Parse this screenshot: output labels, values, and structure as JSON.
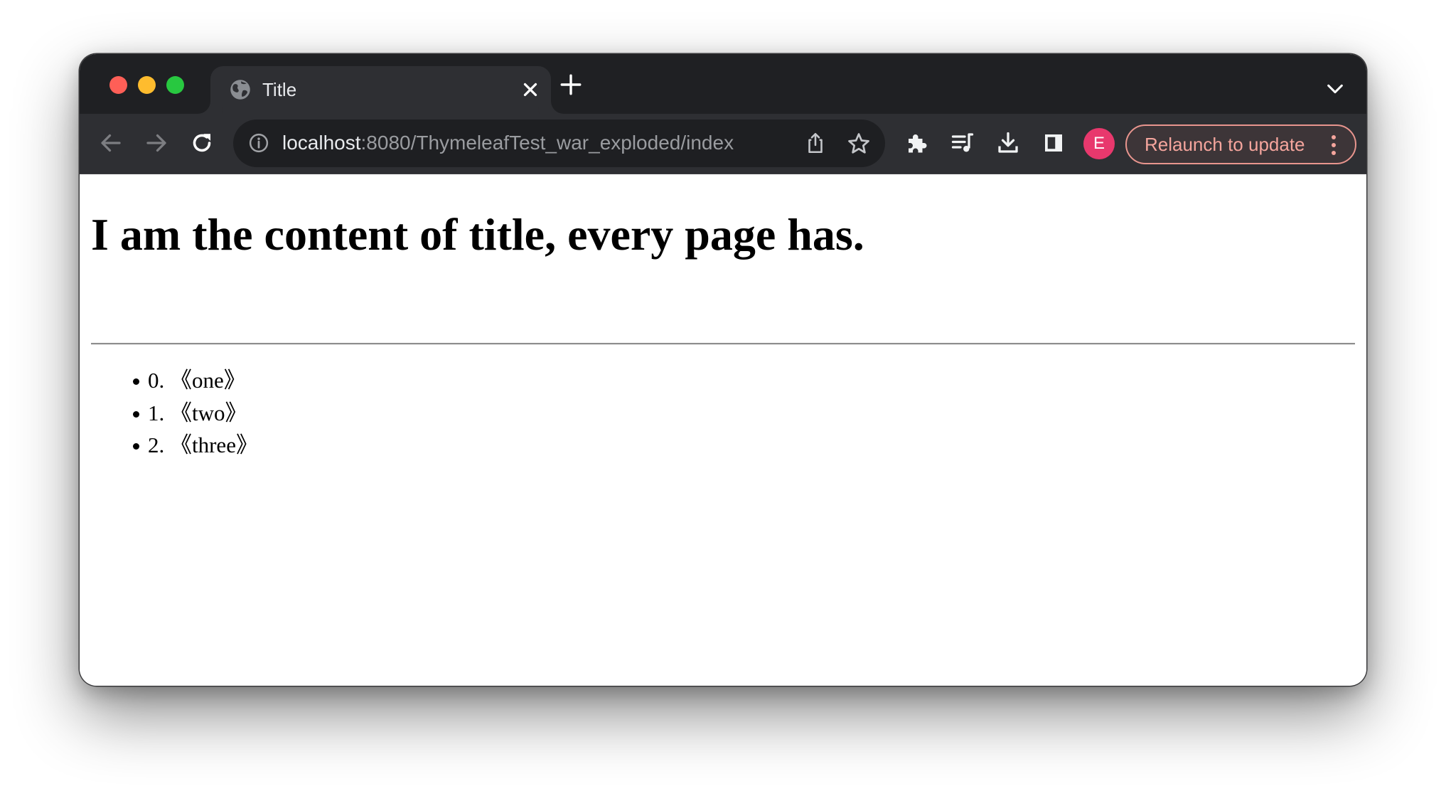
{
  "browser": {
    "tab": {
      "title": "Title",
      "favicon": "globe-icon"
    },
    "tab_strip": {
      "new_tab_icon": "plus-icon",
      "tab_search_icon": "chevron-down-icon"
    },
    "toolbar": {
      "back_icon": "arrow-left-icon",
      "forward_icon": "arrow-right-icon",
      "reload_icon": "reload-icon",
      "url_host": "localhost",
      "url_rest": ":8080/ThymeleafTest_war_exploded/index",
      "site_info_icon": "info-icon",
      "share_icon": "share-icon",
      "bookmark_icon": "star-icon",
      "extensions_icon": "puzzle-icon",
      "media_icon": "media-queue-icon",
      "downloads_icon": "download-icon",
      "side_panel_icon": "side-panel-icon",
      "profile_initial": "E",
      "relaunch_label": "Relaunch to update",
      "menu_icon": "more-vertical-icon"
    },
    "colors": {
      "frame": "#1f2023",
      "toolbar": "#2e2f33",
      "omnibox": "#1e1f22",
      "avatar": "#e8386d",
      "relaunch_accent": "#f5a59d"
    }
  },
  "page": {
    "heading": "I am the content of title, every page has.",
    "items": [
      {
        "text": "0. 《one》"
      },
      {
        "text": "1. 《two》"
      },
      {
        "text": "2. 《three》"
      }
    ]
  }
}
